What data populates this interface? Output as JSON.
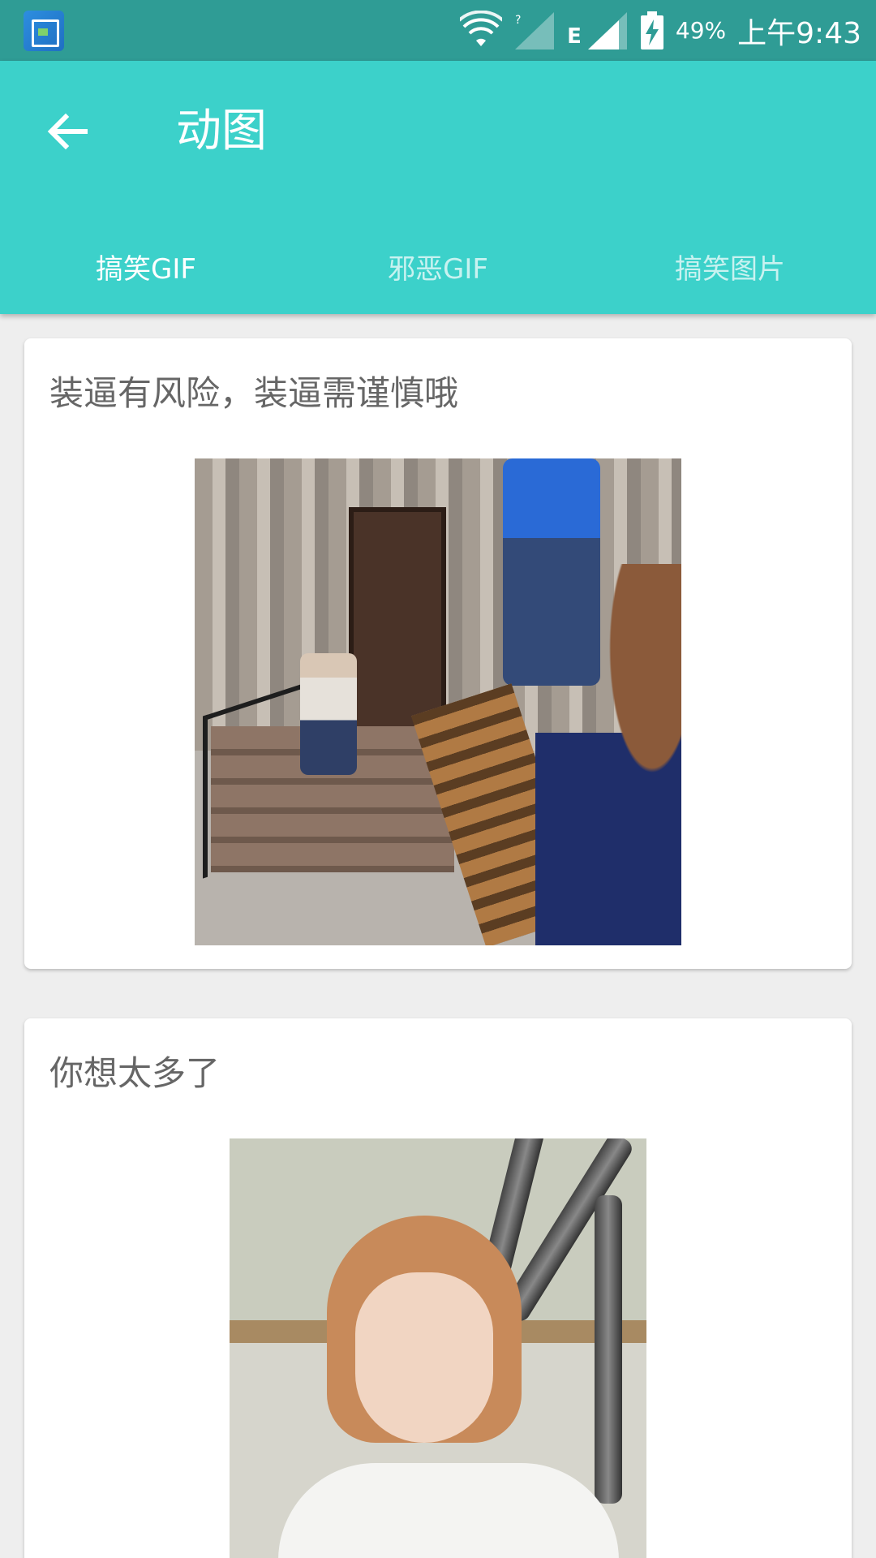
{
  "status_bar": {
    "battery": "49%",
    "time": "上午9:43",
    "network": "E",
    "icons": [
      "gallery-app-icon",
      "wifi-icon",
      "signal-icon",
      "battery-charging-icon"
    ]
  },
  "app_bar": {
    "title": "动图",
    "back_icon": "arrow-left-icon",
    "background": "#3cd1ca"
  },
  "tabs": [
    {
      "label": "搞笑GIF",
      "active": true
    },
    {
      "label": "邪恶GIF",
      "active": false
    },
    {
      "label": "搞笑图片",
      "active": false
    }
  ],
  "posts": [
    {
      "title": "装逼有风险，装逼需谨慎哦"
    },
    {
      "title": "你想太多了"
    }
  ]
}
